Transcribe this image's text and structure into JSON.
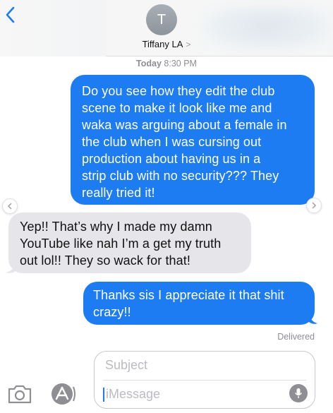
{
  "header": {
    "avatar_initial": "T",
    "contact_name": "Tiffany LA",
    "contact_chevron": ">"
  },
  "timestamp": {
    "day": "Today",
    "time": "8:30 PM"
  },
  "messages": [
    {
      "direction": "outgoing",
      "lines": [
        "Do you see how they edit the club",
        "scene to make it look like me and",
        "waka was arguing about a female in",
        "the club when I was cursing out",
        "production about having us in a",
        "strip club with no security??? They",
        "really tried it!"
      ]
    },
    {
      "direction": "incoming",
      "lines": [
        "Yep!! That’s why I made my damn",
        "YouTube like nah I’m a get my truth",
        "out lol!! They so wack for that!"
      ]
    },
    {
      "direction": "outgoing",
      "lines": [
        "Thanks sis I appreciate it that shit",
        "crazy!!"
      ]
    }
  ],
  "status": "Delivered",
  "compose": {
    "subject_placeholder": "Subject",
    "message_placeholder": "iMessage"
  },
  "colors": {
    "outgoing_bubble": "#1d7cf2",
    "incoming_bubble": "#e5e5ea",
    "accent": "#1d7cf2"
  },
  "icons": {
    "back": "chevron-left-icon",
    "camera": "camera-icon",
    "apps": "app-store-icon",
    "mic": "microphone-icon",
    "scroll_left": "chevron-left-icon",
    "scroll_right": "chevron-right-icon"
  }
}
